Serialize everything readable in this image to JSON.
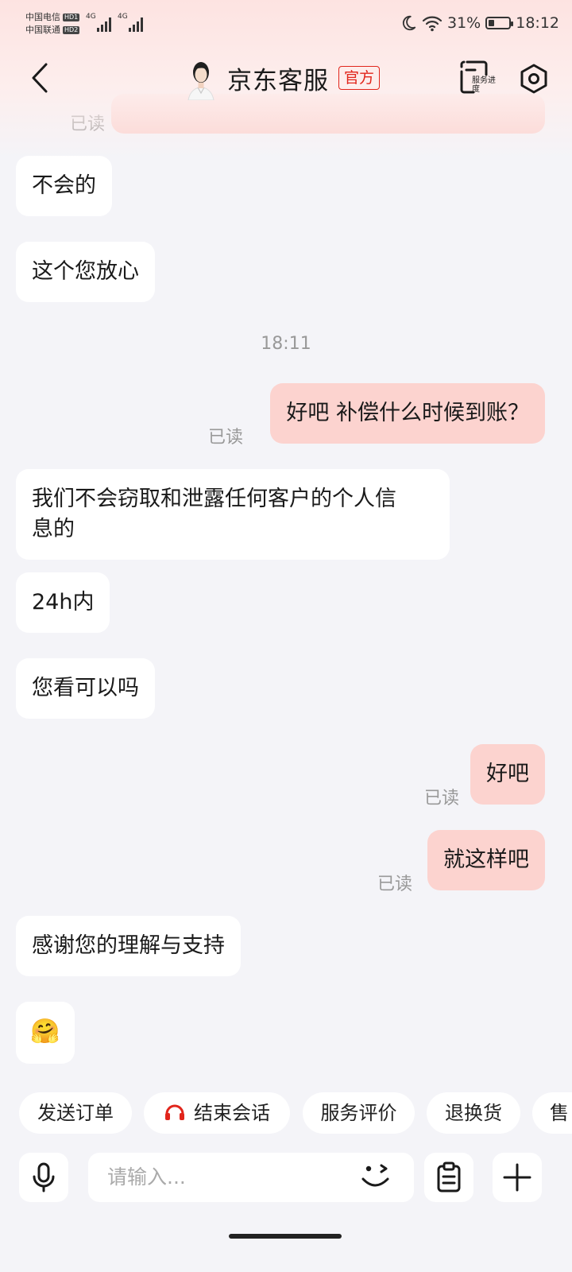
{
  "status_bar": {
    "carrier1": "中国电信",
    "carrier1_hd": "HD1",
    "carrier2": "中国联通",
    "carrier2_hd": "HD2",
    "network1": "4G",
    "network2": "4G",
    "battery": "31%",
    "battery_level": 0.31,
    "time": "18:12"
  },
  "header": {
    "title": "京东客服",
    "badge": "官方",
    "service_progress": "服务进度",
    "icons": {
      "back": "back-arrow-icon",
      "service": "service-progress-icon",
      "settings": "settings-icon"
    }
  },
  "chat": {
    "partial_read": "已读",
    "messages": [
      {
        "side": "in",
        "text": "不会的"
      },
      {
        "side": "in",
        "text": "这个您放心"
      },
      {
        "side": "time",
        "text": "18:11"
      },
      {
        "side": "out",
        "text": "好吧 补偿什么时候到账？",
        "status": "已读"
      },
      {
        "side": "in",
        "text_line1": "我们不会窃取和泄露任何客户的个人信",
        "text_line2": "息的"
      },
      {
        "side": "in",
        "text": "24h内"
      },
      {
        "side": "in",
        "text": "您看可以吗"
      },
      {
        "side": "out",
        "text": "好吧",
        "status": "已读"
      },
      {
        "side": "out",
        "text": "就这样吧",
        "status": "已读"
      },
      {
        "side": "in",
        "text": "感谢您的理解与支持"
      },
      {
        "side": "in",
        "emoji": "🤗"
      }
    ]
  },
  "quick_actions": [
    "发送订单",
    "结束会话",
    "服务评价",
    "退换货",
    "售"
  ],
  "input": {
    "placeholder": "请输入..."
  },
  "colors": {
    "accent_red": "#e1251b",
    "bubble_out": "#fcd3cf",
    "background": "#f4f4f8"
  }
}
